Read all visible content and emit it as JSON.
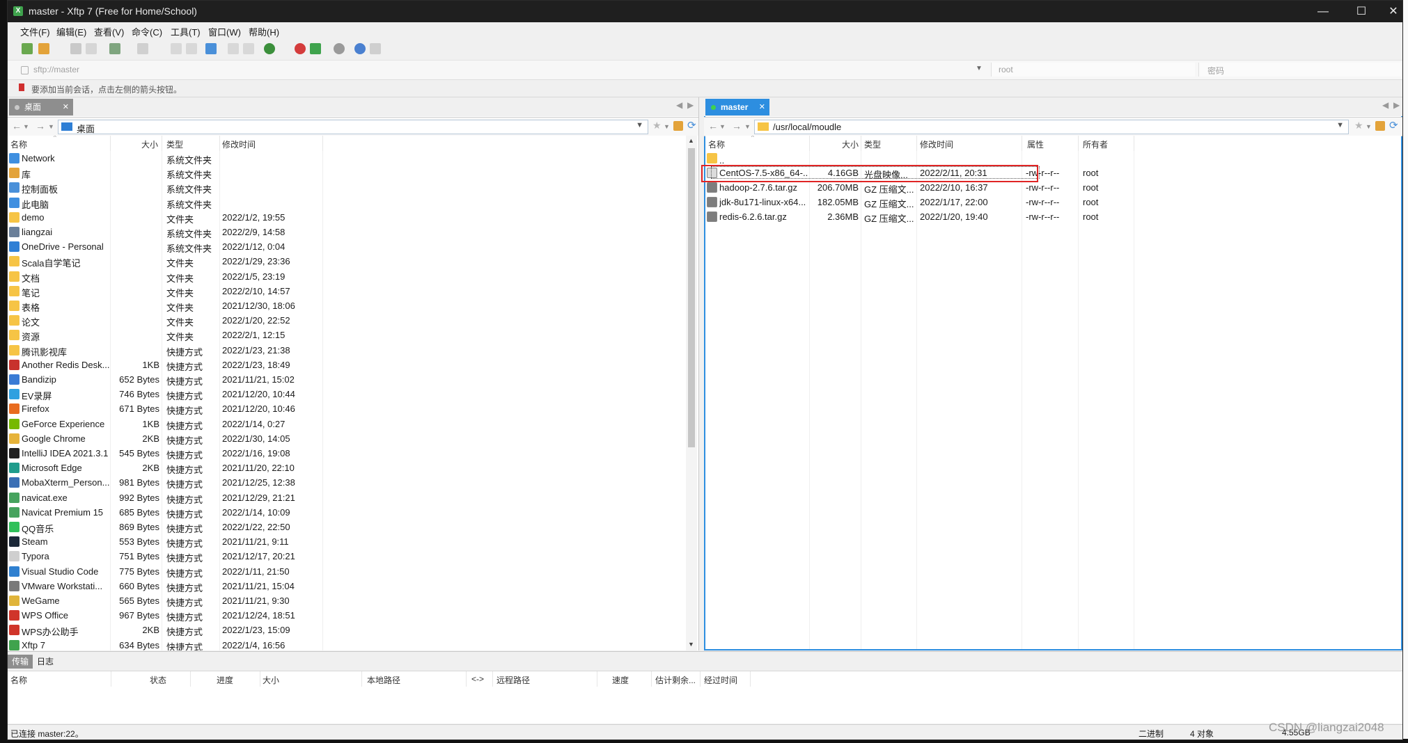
{
  "window": {
    "title": "master - Xftp 7 (Free for Home/School)",
    "controls": [
      "—",
      "☐",
      "✕"
    ]
  },
  "menu": [
    "文件(F)",
    "编辑(E)",
    "查看(V)",
    "命令(C)",
    "工具(T)",
    "窗口(W)",
    "帮助(H)"
  ],
  "address": {
    "url_placeholder": "sftp://master",
    "user_placeholder": "root",
    "password_placeholder": "密码"
  },
  "hint": "要添加当前会话，点击左侧的箭头按钮。",
  "left_pane": {
    "tab_label": "桌面",
    "path": "桌面",
    "columns": [
      "名称",
      "大小",
      "类型",
      "修改时间"
    ],
    "rows": [
      {
        "icon": "network-icon",
        "name": "Network",
        "size": "",
        "type": "系统文件夹",
        "modified": ""
      },
      {
        "icon": "library-icon",
        "name": "库",
        "size": "",
        "type": "系统文件夹",
        "modified": ""
      },
      {
        "icon": "control-panel-icon",
        "name": "控制面板",
        "size": "",
        "type": "系统文件夹",
        "modified": ""
      },
      {
        "icon": "computer-icon",
        "name": "此电脑",
        "size": "",
        "type": "系统文件夹",
        "modified": ""
      },
      {
        "icon": "folder-icon",
        "name": "demo",
        "size": "",
        "type": "文件夹",
        "modified": "2022/1/2, 19:55"
      },
      {
        "icon": "user-icon",
        "name": "liangzai",
        "size": "",
        "type": "系统文件夹",
        "modified": "2022/2/9, 14:58"
      },
      {
        "icon": "onedrive-icon",
        "name": "OneDrive - Personal",
        "size": "",
        "type": "系统文件夹",
        "modified": "2022/1/12, 0:04"
      },
      {
        "icon": "folder-icon",
        "name": "Scala自学笔记",
        "size": "",
        "type": "文件夹",
        "modified": "2022/1/29, 23:36"
      },
      {
        "icon": "folder-icon",
        "name": "文档",
        "size": "",
        "type": "文件夹",
        "modified": "2022/1/5, 23:19"
      },
      {
        "icon": "folder-icon",
        "name": "笔记",
        "size": "",
        "type": "文件夹",
        "modified": "2022/2/10, 14:57"
      },
      {
        "icon": "folder-icon",
        "name": "表格",
        "size": "",
        "type": "文件夹",
        "modified": "2021/12/30, 18:06"
      },
      {
        "icon": "folder-icon",
        "name": "论文",
        "size": "",
        "type": "文件夹",
        "modified": "2022/1/20, 22:52"
      },
      {
        "icon": "folder-icon",
        "name": "资源",
        "size": "",
        "type": "文件夹",
        "modified": "2022/2/1, 12:15"
      },
      {
        "icon": "folder-icon",
        "name": "腾讯影视库",
        "size": "",
        "type": "快捷方式",
        "modified": "2022/1/23, 21:38"
      },
      {
        "icon": "redis-icon",
        "name": "Another Redis Desk...",
        "size": "1KB",
        "type": "快捷方式",
        "modified": "2022/1/23, 18:49"
      },
      {
        "icon": "bandizip-icon",
        "name": "Bandizip",
        "size": "652 Bytes",
        "type": "快捷方式",
        "modified": "2021/11/21, 15:02"
      },
      {
        "icon": "ev-icon",
        "name": "EV录屏",
        "size": "746 Bytes",
        "type": "快捷方式",
        "modified": "2021/12/20, 10:44"
      },
      {
        "icon": "firefox-icon",
        "name": "Firefox",
        "size": "671 Bytes",
        "type": "快捷方式",
        "modified": "2021/12/20, 10:46"
      },
      {
        "icon": "geforce-icon",
        "name": "GeForce Experience",
        "size": "1KB",
        "type": "快捷方式",
        "modified": "2022/1/14, 0:27"
      },
      {
        "icon": "chrome-icon",
        "name": "Google Chrome",
        "size": "2KB",
        "type": "快捷方式",
        "modified": "2022/1/30, 14:05"
      },
      {
        "icon": "intellij-icon",
        "name": "IntelliJ IDEA 2021.3.1",
        "size": "545 Bytes",
        "type": "快捷方式",
        "modified": "2022/1/16, 19:08"
      },
      {
        "icon": "edge-icon",
        "name": "Microsoft Edge",
        "size": "2KB",
        "type": "快捷方式",
        "modified": "2021/11/20, 22:10"
      },
      {
        "icon": "mobaxterm-icon",
        "name": "MobaXterm_Person...",
        "size": "981 Bytes",
        "type": "快捷方式",
        "modified": "2021/12/25, 12:38"
      },
      {
        "icon": "navicat-icon",
        "name": "navicat.exe",
        "size": "992 Bytes",
        "type": "快捷方式",
        "modified": "2021/12/29, 21:21"
      },
      {
        "icon": "navicat-icon",
        "name": "Navicat Premium 15",
        "size": "685 Bytes",
        "type": "快捷方式",
        "modified": "2022/1/14, 10:09"
      },
      {
        "icon": "qqmusic-icon",
        "name": "QQ音乐",
        "size": "869 Bytes",
        "type": "快捷方式",
        "modified": "2022/1/22, 22:50"
      },
      {
        "icon": "steam-icon",
        "name": "Steam",
        "size": "553 Bytes",
        "type": "快捷方式",
        "modified": "2021/11/21, 9:11"
      },
      {
        "icon": "typora-icon",
        "name": "Typora",
        "size": "751 Bytes",
        "type": "快捷方式",
        "modified": "2021/12/17, 20:21"
      },
      {
        "icon": "vscode-icon",
        "name": "Visual Studio Code",
        "size": "775 Bytes",
        "type": "快捷方式",
        "modified": "2022/1/11, 21:50"
      },
      {
        "icon": "vmware-icon",
        "name": "VMware Workstati...",
        "size": "660 Bytes",
        "type": "快捷方式",
        "modified": "2021/11/21, 15:04"
      },
      {
        "icon": "wegame-icon",
        "name": "WeGame",
        "size": "565 Bytes",
        "type": "快捷方式",
        "modified": "2021/11/21, 9:30"
      },
      {
        "icon": "wps-icon",
        "name": "WPS Office",
        "size": "967 Bytes",
        "type": "快捷方式",
        "modified": "2021/12/24, 18:51"
      },
      {
        "icon": "wps-icon",
        "name": "WPS办公助手",
        "size": "2KB",
        "type": "快捷方式",
        "modified": "2022/1/23, 15:09"
      },
      {
        "icon": "xftp-icon",
        "name": "Xftp 7",
        "size": "634 Bytes",
        "type": "快捷方式",
        "modified": "2022/1/4, 16:56"
      }
    ]
  },
  "right_pane": {
    "tab_label": "master",
    "path": "/usr/local/moudle",
    "columns": [
      "名称",
      "大小",
      "类型",
      "修改时间",
      "属性",
      "所有者"
    ],
    "parent_row": "..",
    "rows": [
      {
        "icon": "disc-image-icon",
        "name": "CentOS-7.5-x86_64-...",
        "size": "4.16GB",
        "type": "光盘映像...",
        "modified": "2022/2/11, 20:31",
        "attr": "-rw-r--r--",
        "owner": "root",
        "selected": true
      },
      {
        "icon": "archive-icon",
        "name": "hadoop-2.7.6.tar.gz",
        "size": "206.70MB",
        "type": "GZ 压缩文...",
        "modified": "2022/2/10, 16:37",
        "attr": "-rw-r--r--",
        "owner": "root"
      },
      {
        "icon": "archive-icon",
        "name": "jdk-8u171-linux-x64...",
        "size": "182.05MB",
        "type": "GZ 压缩文...",
        "modified": "2022/1/17, 22:00",
        "attr": "-rw-r--r--",
        "owner": "root"
      },
      {
        "icon": "archive-icon",
        "name": "redis-6.2.6.tar.gz",
        "size": "2.36MB",
        "type": "GZ 压缩文...",
        "modified": "2022/1/20, 19:40",
        "attr": "-rw-r--r--",
        "owner": "root"
      }
    ]
  },
  "transfer": {
    "tabs": [
      "传输",
      "日志"
    ],
    "columns": [
      "名称",
      "状态",
      "进度",
      "大小",
      "本地路径",
      "<->",
      "远程路径",
      "速度",
      "估计剩余...",
      "经过时间"
    ]
  },
  "status": {
    "connection": "已连接 master:22。",
    "mode": "二进制",
    "objects": "4 对象",
    "size": "4.55GB"
  },
  "watermark": "CSDN @liangzai2048",
  "colors": {
    "accent": "#2d8ee0",
    "selection_box": "#e02424",
    "folder": "#f6c445"
  }
}
